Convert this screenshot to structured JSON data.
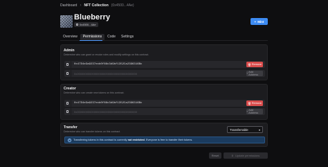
{
  "breadcrumb": {
    "root": "Dashboard",
    "separator": "›",
    "current": "NFT Collection",
    "address": "(0x4500...4Ae)"
  },
  "header": {
    "title": "Blueberry",
    "address": "0x4500...4Ae",
    "mint_button": "Mint"
  },
  "tabs": [
    "Overview",
    "Permissions",
    "Code",
    "Settings"
  ],
  "active_tab": "Permissions",
  "admin": {
    "title": "Admin",
    "description": "Determine who can grant or revoke roles and modify settings on this contract.",
    "address": "0x47D4e3a9237ecb0f86c3d9bf1352Ca2396316Bc",
    "remove_label": "Remove",
    "input_placeholder": "0x000000000000000000000000000000000000000",
    "add_label": "Add Address"
  },
  "creator": {
    "title": "Creator",
    "description": "Determine who can create new tokens on this contract.",
    "address": "0x47D4e3a9237ecb0f86c3d9bf1352Ca2396316Bc",
    "remove_label": "Remove",
    "input_placeholder": "0x000000000000000000000000000000000000000",
    "add_label": "Add Address"
  },
  "transfer": {
    "title": "Transfer",
    "description": "Determine who can transfer tokens on this contract.",
    "select_value": "Transferrable",
    "info_prefix": "Transferring tokens in this contract is currently",
    "info_bold": "not restricted",
    "info_suffix": ". Everyone is free to transfer their tokens."
  },
  "footer": {
    "reset_label": "Reset",
    "update_count": "0",
    "update_label": "Update permissions"
  },
  "colors": {
    "accent": "#3d8bf2",
    "danger": "#d94c4c",
    "background": "#0e0e10",
    "panel": "#1c1c1f"
  }
}
